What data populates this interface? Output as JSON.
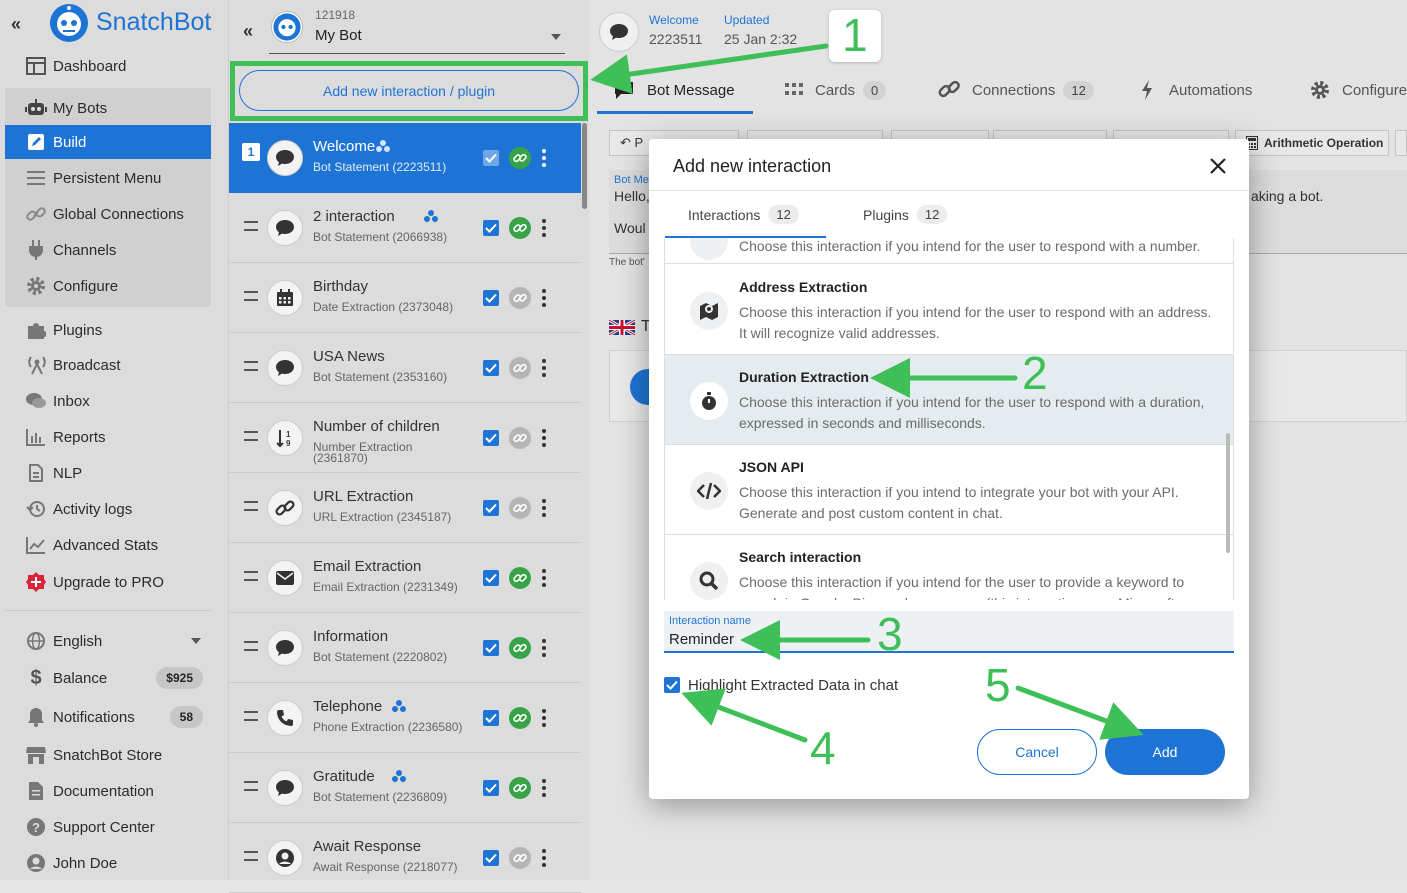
{
  "brand": {
    "name": "SnatchBot"
  },
  "sidebar": {
    "items": [
      {
        "label": "Dashboard",
        "icon": "dashboard-icon"
      },
      {
        "label": "My Bots",
        "icon": "robot-icon"
      },
      {
        "label": "Build",
        "icon": "edit-icon"
      },
      {
        "label": "Persistent Menu",
        "icon": "menu-icon"
      },
      {
        "label": "Global Connections",
        "icon": "link-icon"
      },
      {
        "label": "Channels",
        "icon": "plug-icon"
      },
      {
        "label": "Configure",
        "icon": "gear-icon"
      },
      {
        "label": "Plugins",
        "icon": "puzzle-icon"
      },
      {
        "label": "Broadcast",
        "icon": "broadcast-icon"
      },
      {
        "label": "Inbox",
        "icon": "chat-icon"
      },
      {
        "label": "Reports",
        "icon": "bar-chart-icon"
      },
      {
        "label": "NLP",
        "icon": "nlp-icon"
      },
      {
        "label": "Activity logs",
        "icon": "history-icon"
      },
      {
        "label": "Advanced Stats",
        "icon": "line-chart-icon"
      },
      {
        "label": "Upgrade to PRO",
        "icon": "plus-circle-icon"
      }
    ],
    "language": "English",
    "balance_label": "Balance",
    "balance_value": "$925",
    "notifications_label": "Notifications",
    "notifications_count": "58",
    "store": "SnatchBot Store",
    "docs": "Documentation",
    "support": "Support Center",
    "user": "John Doe"
  },
  "bot": {
    "id": "121918",
    "name": "My Bot",
    "add_button": "Add new interaction / plugin"
  },
  "interactions": [
    {
      "num": "1",
      "title": "Welcome",
      "sub": "Bot Statement (2223511)",
      "icon": "chat-bubble-icon",
      "cluster": true,
      "linked": true
    },
    {
      "title": "2 interaction",
      "sub": "Bot Statement (2066938)",
      "icon": "chat-bubble-icon",
      "cluster": true,
      "linked": true
    },
    {
      "title": "Birthday",
      "sub": "Date Extraction (2373048)",
      "icon": "calendar-icon",
      "linked": false
    },
    {
      "title": "USA News",
      "sub": "Bot Statement (2353160)",
      "icon": "chat-bubble-icon",
      "linked": false
    },
    {
      "title": "Number of children",
      "sub": "Number Extraction",
      "sub2": "(2361870)",
      "icon": "sort-numbers-icon",
      "linked": false
    },
    {
      "title": "URL Extraction",
      "sub": "URL Extraction (2345187)",
      "icon": "link-icon",
      "linked": false
    },
    {
      "title": "Email Extraction",
      "sub": "Email Extraction (2231349)",
      "icon": "envelope-icon",
      "linked": true
    },
    {
      "title": "Information",
      "sub": "Bot Statement (2220802)",
      "icon": "chat-bubble-icon",
      "linked": true
    },
    {
      "title": "Telephone",
      "sub": "Phone Extraction (2236580)",
      "icon": "phone-icon",
      "cluster": true,
      "linked": true
    },
    {
      "title": "Gratitude",
      "sub": "Bot Statement (2236809)",
      "icon": "chat-bubble-icon",
      "cluster": true,
      "linked": true
    },
    {
      "title": "Await Response",
      "sub": "Await Response (2218077)",
      "icon": "user-circle-icon",
      "linked": false
    }
  ],
  "header": {
    "welcome_label": "Welcome",
    "welcome_value": "2223511",
    "updated_label": "Updated",
    "updated_value": "25 Jan 2:32"
  },
  "tabs": [
    {
      "label": "Bot Message"
    },
    {
      "label": "Cards",
      "count": "0"
    },
    {
      "label": "Connections",
      "count": "12"
    },
    {
      "label": "Automations"
    },
    {
      "label": "Configure"
    }
  ],
  "background": {
    "toolbar_last": "Arithmetic Operation",
    "hello": "Hello,",
    "would": "Woul",
    "making": "aking a bot.",
    "bot_me": "Bot Me",
    "botnote": "The bot'",
    "t": "T"
  },
  "modal": {
    "title": "Add new interaction",
    "tabs": [
      {
        "label": "Interactions",
        "count": "12"
      },
      {
        "label": "Plugins",
        "count": "12"
      }
    ],
    "partial_desc": "Choose this interaction if you intend for the user to respond with a number.",
    "items": [
      {
        "title": "Address Extraction",
        "desc": "Choose this interaction if you intend for the user to respond with an address. It will recognize valid addresses.",
        "icon": "map-pin-icon"
      },
      {
        "title": "Duration Extraction",
        "desc": "Choose this interaction if you intend for the user to respond with a duration, expressed in seconds and milliseconds.",
        "icon": "stopwatch-icon"
      },
      {
        "title": "JSON API",
        "desc": "Choose this interaction if you intend to integrate your bot with your API. Generate and post custom content in chat.",
        "icon": "code-icon"
      },
      {
        "title": "Search interaction",
        "desc": "Choose this interaction if you intend for the user to provide a keyword to search in Google, Bing and many more (this interaction uses Microsoft...",
        "icon": "search-icon"
      }
    ],
    "name_label": "Interaction name",
    "name_value": "Reminder",
    "highlight_label": "Highlight Extracted Data in chat",
    "cancel": "Cancel",
    "add": "Add"
  },
  "annotations": [
    "1",
    "2",
    "3",
    "4",
    "5"
  ],
  "colors": {
    "accent": "#1e74d4",
    "annotation": "#3fbf57",
    "active_row": "#1e74d4"
  }
}
